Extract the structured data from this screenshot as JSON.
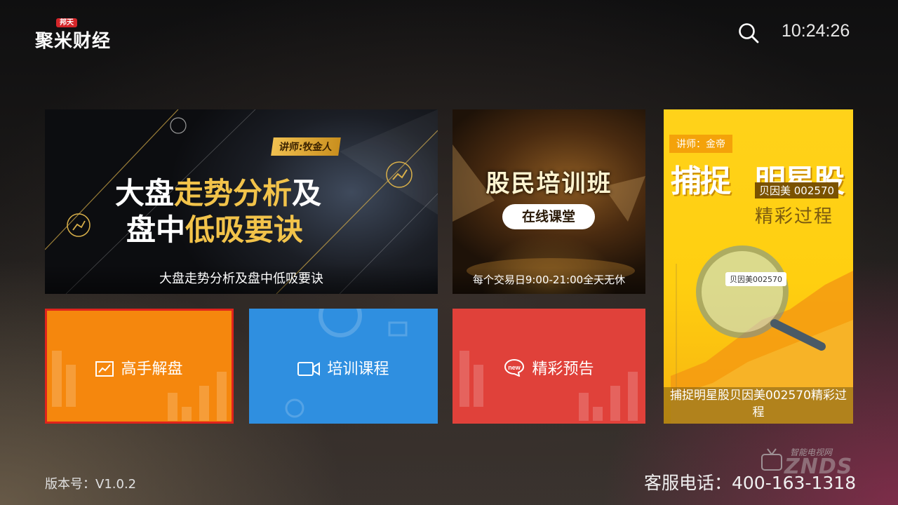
{
  "header": {
    "brand_badge": "邦天",
    "brand_name": "聚米财经",
    "clock": "10:24:26"
  },
  "banners": {
    "main": {
      "tag": "讲师:牧金人",
      "line1_a": "大盘",
      "line1_b": "走势分析",
      "line1_c": "及",
      "line2_a": "盘中",
      "line2_b": "低吸要诀",
      "caption": "大盘走势分析及盘中低吸要诀"
    },
    "training": {
      "title": "股民培训班",
      "pill": "在线课堂",
      "caption": "每个交易日9:00-21:00全天无休"
    },
    "stock": {
      "lecturer": "讲师：金帝",
      "headline_a": "捕捉",
      "headline_b": "明星股",
      "stock_name": "贝因美 002570",
      "subtitle": "精彩过程",
      "lens_label": "贝因美002570",
      "caption": "捕捉明星股贝因美002570精彩过程"
    }
  },
  "tiles": {
    "analysis": "高手解盘",
    "training": "培训课程",
    "preview": "精彩预告",
    "preview_icon_text": "new"
  },
  "footer": {
    "version": "版本号：V1.0.2",
    "hotline": "客服电话：400-163-1318",
    "watermark_top": "智能电视网",
    "watermark_main": "ZNDS"
  },
  "colors": {
    "orange_tile": "#f5870d",
    "blue_tile": "#2f8fe0",
    "red_tile": "#e0413a",
    "focus_border": "#e0241c",
    "stock_banner": "#ffd21a",
    "gold_text": "#f2c34a"
  }
}
